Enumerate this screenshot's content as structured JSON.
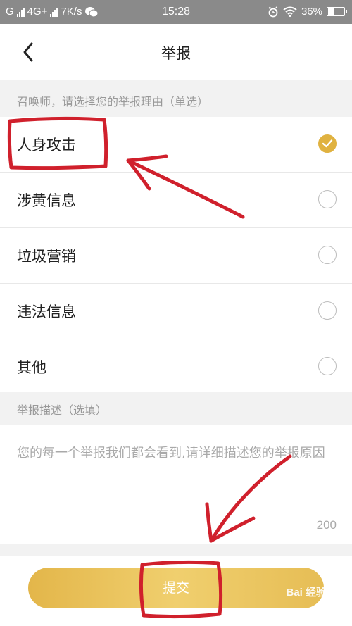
{
  "status_bar": {
    "carrier_left": "G",
    "network": "4G+",
    "speed": "7K/s",
    "time": "15:28",
    "battery_percent": "36%",
    "battery_level": 0.36
  },
  "header": {
    "title": "举报"
  },
  "reasons": {
    "prompt": "召唤师，请选择您的举报理由（单选）",
    "options": [
      {
        "label": "人身攻击",
        "checked": true
      },
      {
        "label": "涉黄信息",
        "checked": false
      },
      {
        "label": "垃圾营销",
        "checked": false
      },
      {
        "label": "违法信息",
        "checked": false
      },
      {
        "label": "其他",
        "checked": false
      }
    ]
  },
  "description": {
    "section_label": "举报描述（选填）",
    "placeholder": "您的每一个举报我们都会看到,请详细描述您的举报原因",
    "char_limit": "200"
  },
  "submit": {
    "label": "提交"
  },
  "watermark": "Bai 经验",
  "colors": {
    "accent": "#e0b240",
    "annotation": "#d0202c",
    "status_bar": "#8a8a8a"
  }
}
